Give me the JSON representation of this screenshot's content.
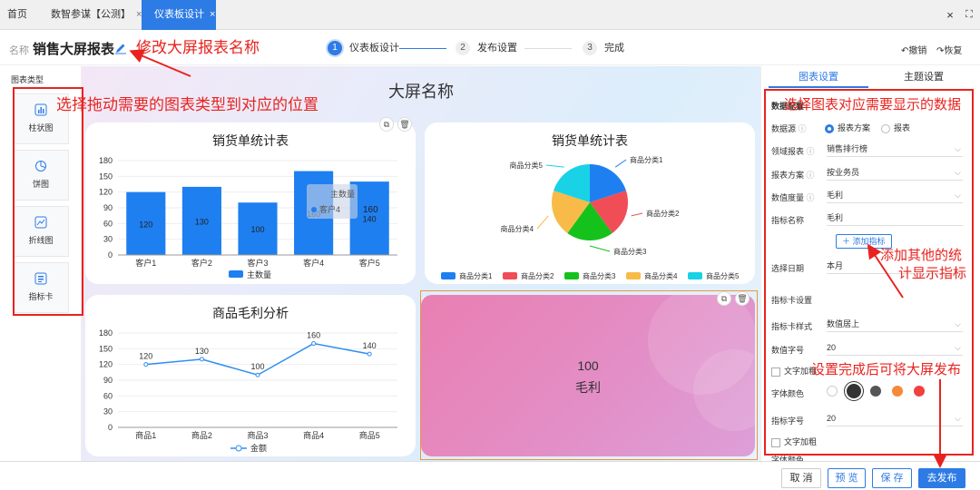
{
  "tabs": [
    {
      "label": "首页",
      "closable": false,
      "active": false
    },
    {
      "label": "数智参谋【公测】",
      "closable": true,
      "active": false
    },
    {
      "label": "仪表板设计",
      "closable": true,
      "active": true
    }
  ],
  "window_icons": {
    "close": "×",
    "fullscreen": "⛶"
  },
  "header": {
    "name_label": "名称",
    "name_value": "销售大屏报表",
    "steps": [
      {
        "num": "1",
        "label": "仪表板设计",
        "active": true
      },
      {
        "num": "2",
        "label": "发布设置",
        "active": false
      },
      {
        "num": "3",
        "label": "完成",
        "active": false
      }
    ],
    "undo_label": "撤销",
    "redo_label": "恢复"
  },
  "sidebar": {
    "title": "图表类型",
    "items": [
      {
        "label": "柱状图",
        "icon": "bar-chart-icon"
      },
      {
        "label": "饼图",
        "icon": "pie-chart-icon"
      },
      {
        "label": "折线图",
        "icon": "line-chart-icon"
      },
      {
        "label": "指标卡",
        "icon": "kpi-card-icon"
      }
    ]
  },
  "canvas": {
    "title": "大屏名称",
    "kpi": {
      "value": "100",
      "label": "毛利"
    }
  },
  "right_panel": {
    "tabs": [
      "图表设置",
      "主题设置"
    ],
    "section_data": "数据配置",
    "source_label": "数据源",
    "source_options": [
      "报表方案",
      "报表"
    ],
    "domain_label": "领域报表",
    "domain_value": "销售排行榜",
    "plan_label": "报表方案",
    "plan_value": "按业务员",
    "measure_label": "数值度量",
    "measure_value": "毛利",
    "metric_name_label": "指标名称",
    "metric_name_value": "毛利",
    "add_metric": "添加指标",
    "date_label": "选择日期",
    "date_value": "本月",
    "card_section": "指标卡设置",
    "card_style_label": "指标卡样式",
    "card_style_value": "数值居上",
    "value_size_label": "数值字号",
    "value_size_value": "20",
    "bold_label": "文字加粗",
    "font_color_label": "字体颜色",
    "colors": [
      "#ffffff",
      "#333333",
      "#555555",
      "#f5893a",
      "#f04040"
    ],
    "label_size_label": "指标字号",
    "label_size_value": "20",
    "bold2_label": "文字加粗",
    "font_color2_label": "字体颜色"
  },
  "bottom": {
    "cancel": "取 消",
    "preview": "预 览",
    "save": "保 存",
    "publish": "去发布"
  },
  "annotations": {
    "rename": "修改大屏报表名称",
    "drag": "选择拖动需要的图表类型到对应的位置",
    "data": "选择图表对应需要显示的数据",
    "add_line1": "添加其他的统",
    "add_line2": "计显示指标",
    "publish": "设置完成后可将大屏发布"
  },
  "chart_data": [
    {
      "type": "bar",
      "title": "销货单统计表",
      "categories": [
        "客户1",
        "客户2",
        "客户3",
        "客户4",
        "客户5"
      ],
      "series": [
        {
          "name": "主数量",
          "values": [
            120,
            130,
            100,
            160,
            140
          ],
          "color": "#1e7ff0"
        }
      ],
      "ylim": [
        0,
        180
      ],
      "yticks": [
        0,
        30,
        60,
        90,
        120,
        150,
        180
      ],
      "tooltip": {
        "title": "主数量",
        "category": "客户4",
        "value": "160"
      }
    },
    {
      "type": "pie",
      "title": "销货单统计表",
      "series": [
        {
          "name": "商品分类1",
          "value": 20,
          "color": "#1e7ff0"
        },
        {
          "name": "商品分类2",
          "value": 20,
          "color": "#f04d57"
        },
        {
          "name": "商品分类3",
          "value": 20,
          "color": "#14c21b"
        },
        {
          "name": "商品分类4",
          "value": 20,
          "color": "#f9bb47"
        },
        {
          "name": "商品分类5",
          "value": 20,
          "color": "#19d2e6"
        }
      ]
    },
    {
      "type": "line",
      "title": "商品毛利分析",
      "categories": [
        "商品1",
        "商品2",
        "商品3",
        "商品4",
        "商品5"
      ],
      "series": [
        {
          "name": "金额",
          "values": [
            120,
            130,
            100,
            160,
            140
          ],
          "color": "#2f8ef0"
        }
      ],
      "ylim": [
        0,
        180
      ],
      "yticks": [
        0,
        30,
        60,
        90,
        120,
        150,
        180
      ]
    }
  ]
}
